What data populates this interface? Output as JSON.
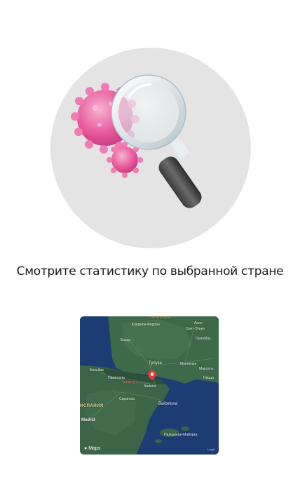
{
  "caption": "Смотрите статистику по выбранной стране",
  "map": {
    "brand": "Maps",
    "legal": "Legal",
    "labels": {
      "france": "ФРАНЦИЯ",
      "clermont": "Клермон-Ферран",
      "lyon": "Лион",
      "saint_etienne": "Сент-Этьен",
      "bordeaux": "Бордо",
      "grenoble": "Гренобль",
      "bilbao": "Бильбао",
      "toulouse": "Тулуза",
      "montpellier": "Монпелье",
      "marseille": "Марсель",
      "pamplona": "Памплона",
      "andorra": "Andorra",
      "aragon": "АРАГОН",
      "nice": "Ницца",
      "spain": "ИСПАНИЯ",
      "zaragoza": "Сарагоса",
      "barcelona": "Barcelona",
      "madrid": "Madrid",
      "palma": "Пальма-де-Майорка"
    }
  }
}
